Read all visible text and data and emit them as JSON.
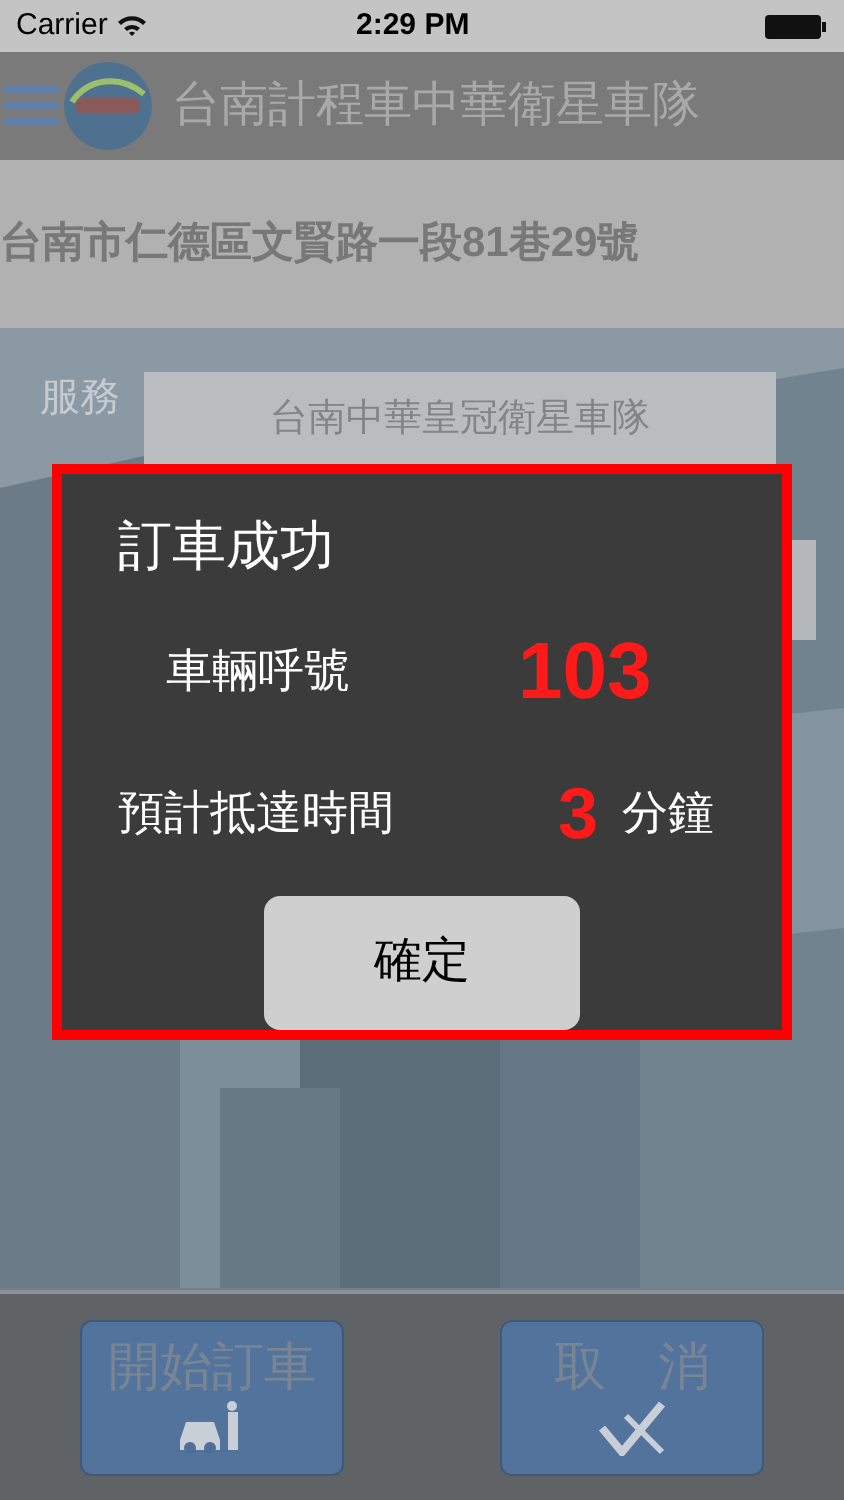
{
  "status_bar": {
    "carrier": "Carrier",
    "time": "2:29 PM"
  },
  "nav_bar": {
    "title": "台南計程車中華衛星車隊"
  },
  "address": "台南市仁德區文賢路一段81巷29號",
  "form": {
    "service_label": "服務",
    "service_value": "台南中華皇冠衛星車隊"
  },
  "dialog": {
    "title": "訂車成功",
    "rows": [
      {
        "label": "車輛呼號",
        "value": "103"
      },
      {
        "label": "預計抵達時間",
        "value": "3",
        "unit": "分鐘"
      }
    ],
    "button": "確定"
  },
  "bottom_buttons": [
    {
      "kind": "order",
      "label": "開始訂車"
    },
    {
      "kind": "cancel",
      "label": "取　消"
    }
  ]
}
